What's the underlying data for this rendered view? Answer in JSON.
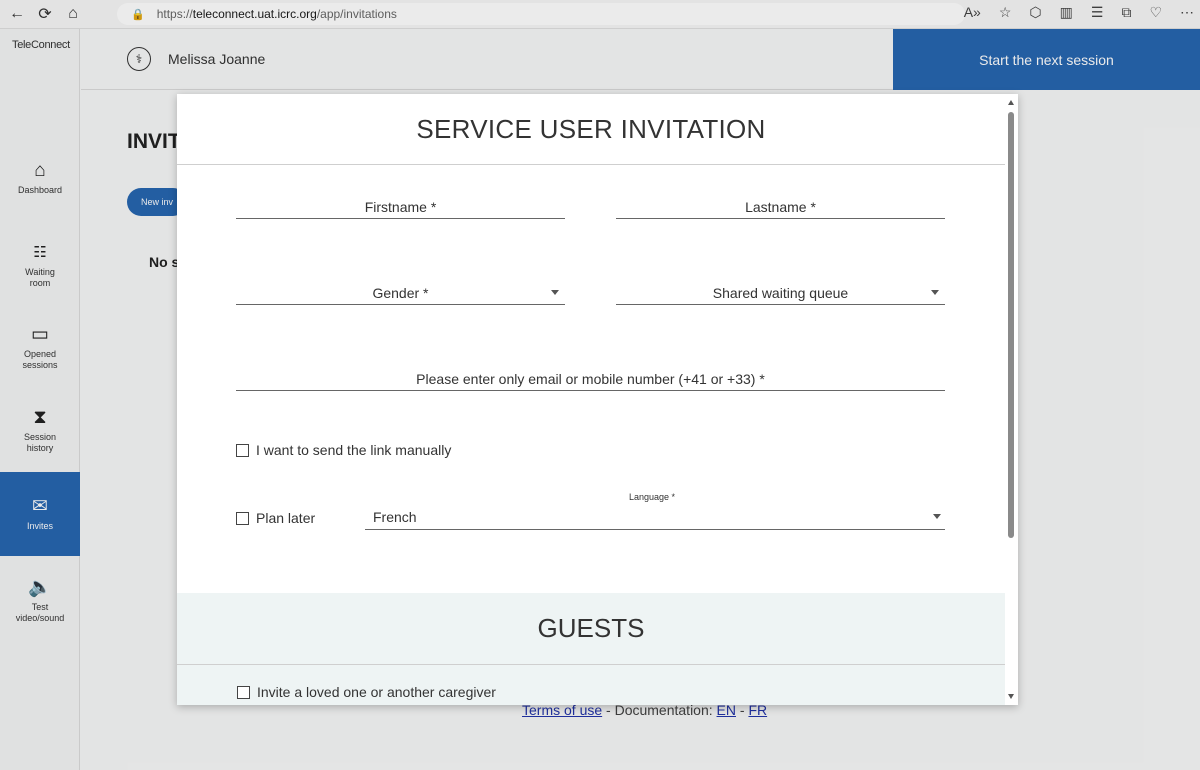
{
  "browser": {
    "url_prefix": "https://",
    "url_host": "teleconnect.uat.icrc.org",
    "url_path": "/app/invitations"
  },
  "sidebar": {
    "logo": "TeleConnect",
    "items": [
      {
        "label": "Dashboard",
        "icon": "home-icon"
      },
      {
        "label": "Waiting room",
        "icon": "group-icon"
      },
      {
        "label": "Opened sessions",
        "icon": "chat-icon"
      },
      {
        "label": "Session history",
        "icon": "hourglass-icon"
      },
      {
        "label": "Invites",
        "icon": "mail-icon"
      },
      {
        "label": "Test video/sound",
        "icon": "speaker-icon"
      }
    ]
  },
  "topbar": {
    "user_name": "Melissa Joanne",
    "start_button": "Start the next session"
  },
  "background": {
    "title": "INVIT",
    "pill": "New inv",
    "empty": "No s"
  },
  "modal": {
    "title": "SERVICE USER INVITATION",
    "firstname": "Firstname *",
    "lastname": "Lastname *",
    "gender": "Gender *",
    "queue": "Shared waiting queue",
    "contact": "Please enter only email or mobile number (+41 or +33) *",
    "manual_link": "I want to send the link manually",
    "plan_later": "Plan later",
    "language_label": "Language *",
    "language_value": "French",
    "guests_title": "GUESTS",
    "invite_guest": "Invite a loved one or another caregiver"
  },
  "footer": {
    "terms": "Terms of use",
    "sep": " - Documentation: ",
    "en": "EN",
    "dash": " - ",
    "fr": "FR"
  },
  "colors": {
    "primary": "#2766b0"
  }
}
